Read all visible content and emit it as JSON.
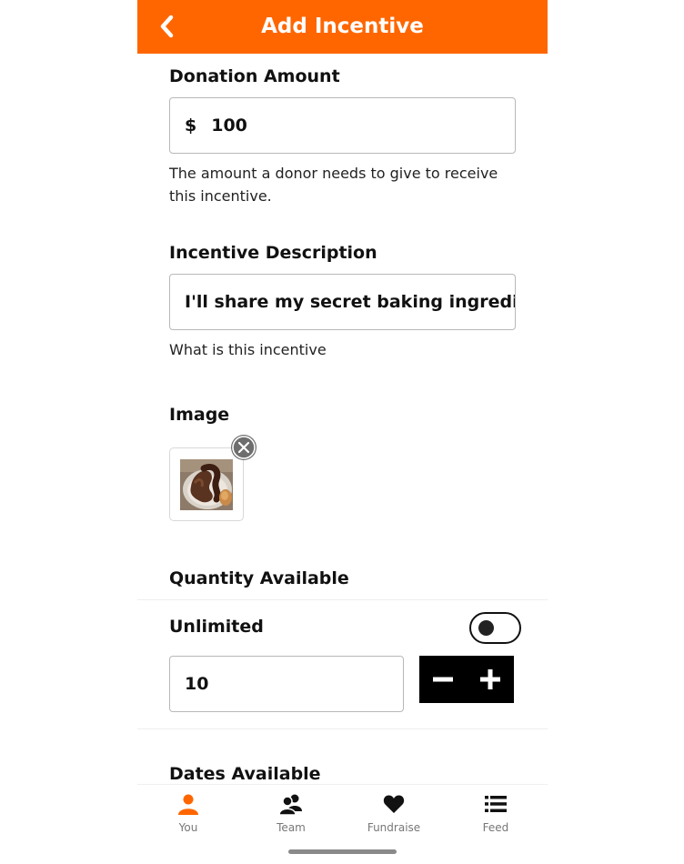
{
  "header": {
    "title": "Add Incentive",
    "back_icon": "chevron-left-icon",
    "color": "#ff6600"
  },
  "donation": {
    "label": "Donation Amount",
    "currency": "$",
    "value": "100",
    "help": "The amount a donor needs to give to receive this incentive."
  },
  "description": {
    "label": "Incentive Description",
    "value": "I'll share my secret baking ingredient",
    "help": "What is this incentive"
  },
  "image": {
    "label": "Image",
    "remove_icon": "close-circle-icon"
  },
  "quantity": {
    "label": "Quantity Available",
    "unlimited_label": "Unlimited",
    "unlimited_on": false,
    "value": "10",
    "decrement_icon": "minus-icon",
    "increment_icon": "plus-icon"
  },
  "dates": {
    "label": "Dates Available"
  },
  "tabbar": {
    "tabs": [
      {
        "label": "You",
        "icon": "person-icon",
        "active": true
      },
      {
        "label": "Team",
        "icon": "team-icon",
        "active": false
      },
      {
        "label": "Fundraise",
        "icon": "heart-icon",
        "active": false
      },
      {
        "label": "Feed",
        "icon": "list-icon",
        "active": false
      }
    ],
    "active_color": "#ff6600"
  }
}
